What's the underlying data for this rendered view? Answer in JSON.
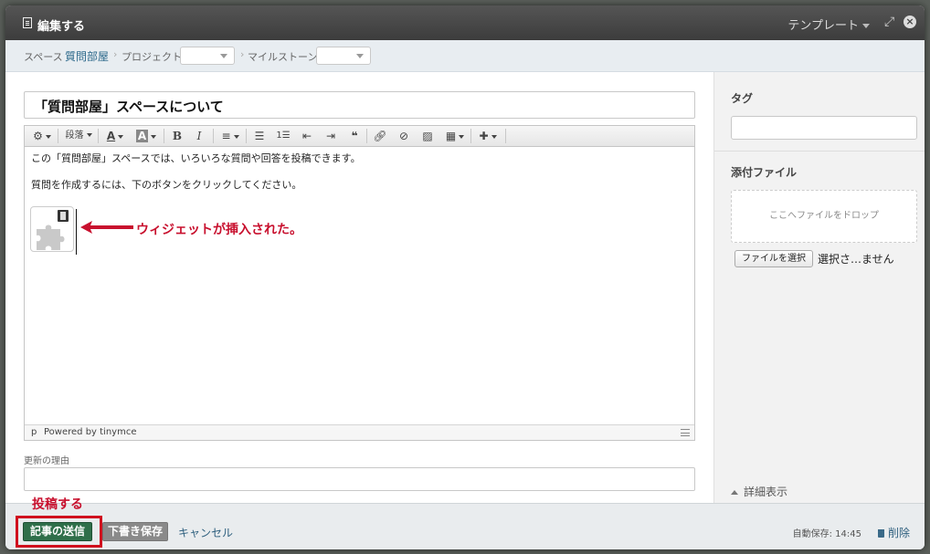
{
  "header": {
    "title": "編集する",
    "template_label": "テンプレート"
  },
  "breadcrumb": {
    "space_label": "スペース",
    "space_name": "質問部屋",
    "project_label": "プロジェクト",
    "milestone_label": "マイルストーン",
    "separator": "›"
  },
  "article": {
    "title": "「質問部屋」スペースについて"
  },
  "toolbar": {
    "paragraph_label": "段落"
  },
  "editor": {
    "paragraph_1": "この「質問部屋」スペースでは、いろいろな質問や回答を投稿できます。",
    "paragraph_2": "質問を作成するには、下のボタンをクリックしてください。",
    "status_path": "p",
    "powered_by": "Powered by tinymce"
  },
  "annotations": {
    "widget_note": "ウィジェットが挿入された。",
    "post_note": "投稿する",
    "color": "#c8102e"
  },
  "reason": {
    "label": "更新の理由",
    "value": ""
  },
  "sidebar": {
    "tag_label": "タグ",
    "tag_value": "",
    "attachments_label": "添付ファイル",
    "dropzone_text": "ここへファイルをドロップ",
    "file_button": "ファイルを選択",
    "file_status": "選択さ…ません",
    "details_toggle": "詳細表示"
  },
  "footer": {
    "submit_label": "記事の送信",
    "draft_label": "下書き保存",
    "cancel_label": "キャンセル",
    "autosave": "自動保存: 14:45",
    "delete_label": "削除"
  },
  "colors": {
    "submit_green": "#2f6f4a",
    "link_blue": "#2e5f7e",
    "highlight_red": "#d0101e"
  }
}
